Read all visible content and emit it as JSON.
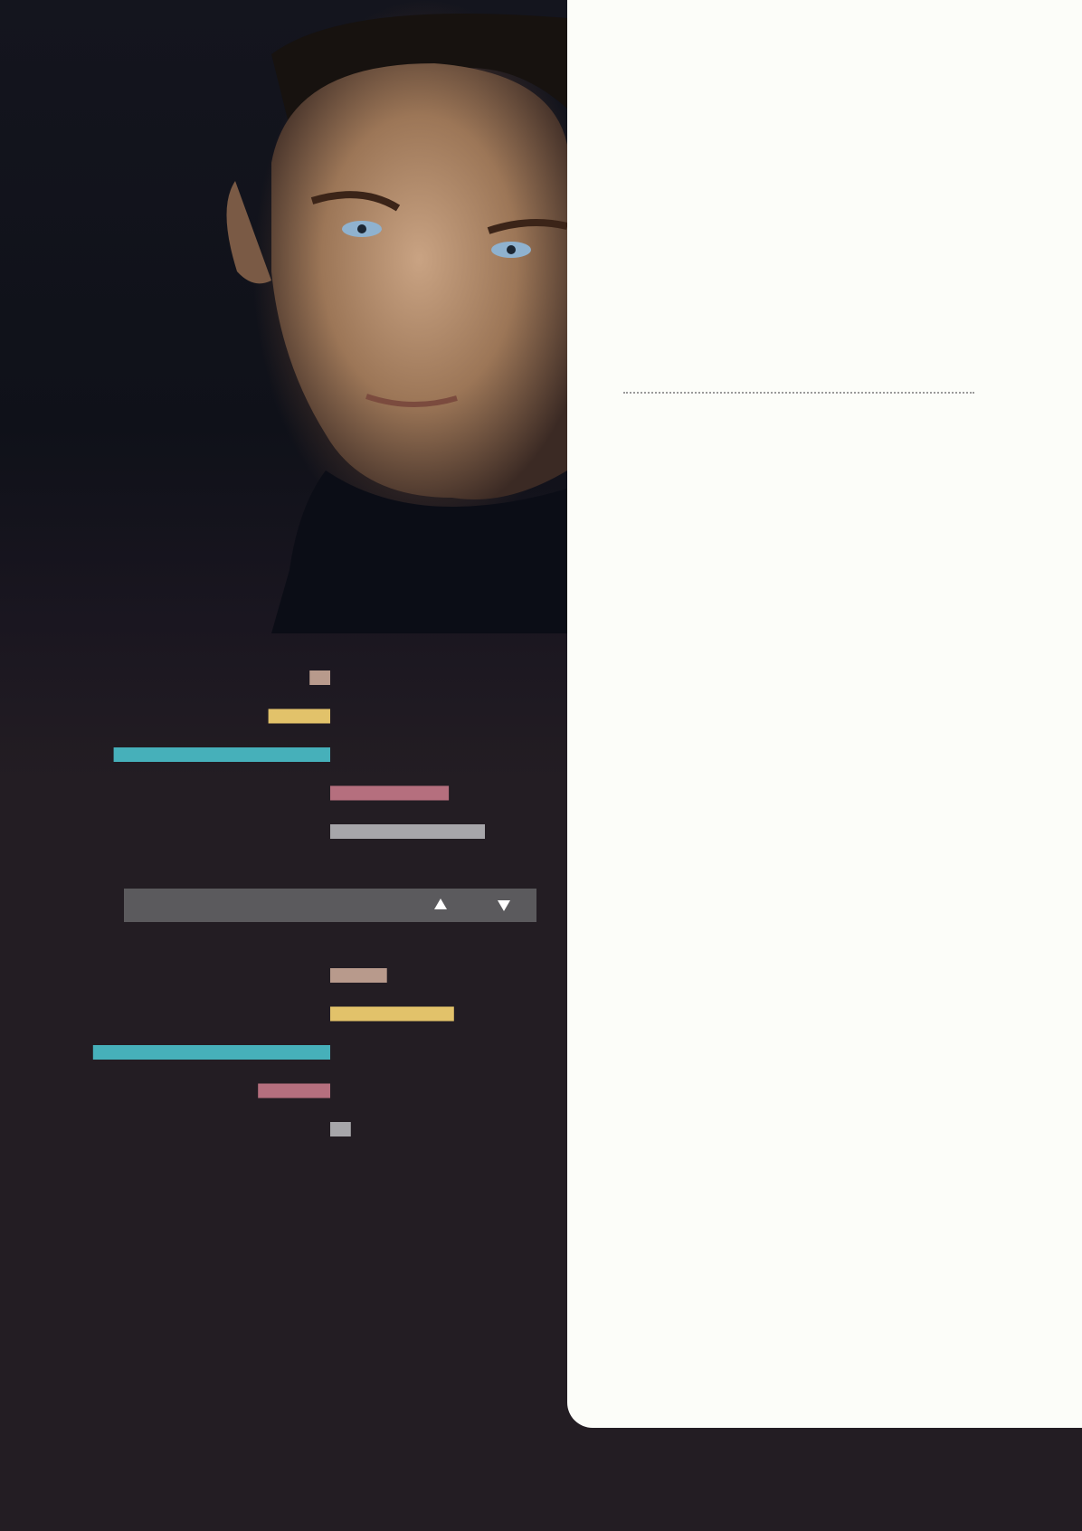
{
  "colors": {
    "background": "#231d23",
    "panel": "#fcfdf9",
    "divider": "#5b5a5d",
    "palette": [
      "#b89a8c",
      "#e2c26a",
      "#46b0ba",
      "#b56f7e",
      "#a7a6aa"
    ]
  },
  "image": {
    "subject": "portrait-photo"
  },
  "controls": {
    "up_icon": "triangle-up-icon",
    "down_icon": "triangle-down-icon"
  },
  "chart_data": [
    {
      "type": "bar",
      "orientation": "horizontal-diverging",
      "categories": [
        "",
        "",
        "",
        "",
        ""
      ],
      "values": [
        -2,
        -6,
        -21,
        11.5,
        15
      ],
      "colors": [
        "#b89a8c",
        "#e2c26a",
        "#46b0ba",
        "#b56f7e",
        "#a7a6aa"
      ],
      "xlim": [
        -25,
        25
      ],
      "grid": false
    },
    {
      "type": "bar",
      "orientation": "horizontal-diverging",
      "categories": [
        "",
        "",
        "",
        "",
        ""
      ],
      "values": [
        5.5,
        12,
        -23,
        -7,
        2
      ],
      "colors": [
        "#b89a8c",
        "#e2c26a",
        "#46b0ba",
        "#b56f7e",
        "#a7a6aa"
      ],
      "xlim": [
        -25,
        25
      ],
      "grid": false
    }
  ]
}
